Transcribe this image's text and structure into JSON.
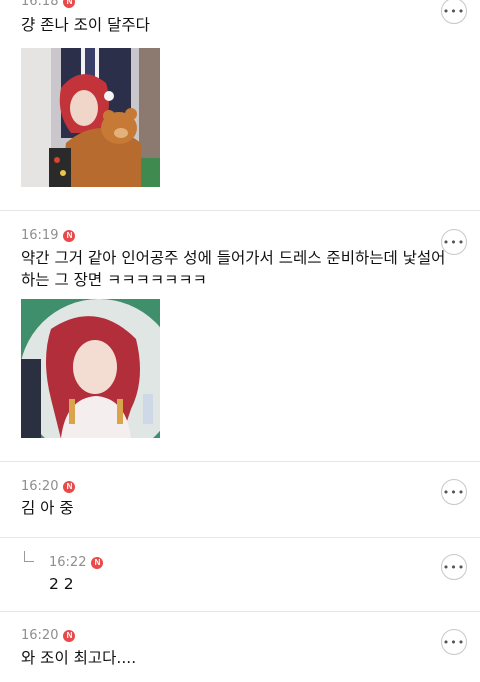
{
  "comments": [
    {
      "time": "16:18",
      "badge": "N",
      "text": "걍 존나 조이 달주다",
      "has_image": true
    },
    {
      "time": "16:19",
      "badge": "N",
      "text_line1": "약간 그거 같아 인어공주 성에 들어가서 드레스 준비하는데 낯설어",
      "text_line2": "하는 그 장면 ㅋㅋㅋㅋㅋㅋㅋ",
      "has_image": true
    },
    {
      "time": "16:20",
      "badge": "N",
      "text": "김 아 중"
    },
    {
      "time": "16:22",
      "badge": "N",
      "text": "2 2",
      "is_reply": true
    },
    {
      "time": "16:20",
      "badge": "N",
      "text": "와 조이 최고다...."
    }
  ],
  "more_button_label": "•••",
  "colors": {
    "badge": "#e84a4a",
    "divider": "#e6e6e6",
    "meta_text": "#8e8e8e"
  }
}
